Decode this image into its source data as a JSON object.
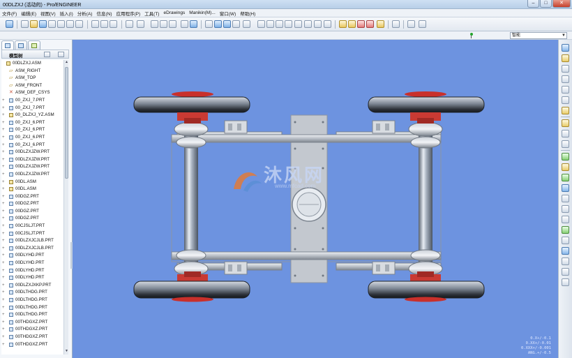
{
  "window": {
    "title": "00DLZXJ (活动的) - Pro/ENGINEER",
    "buttons": {
      "minimize": "–",
      "maximize": "□",
      "close": "✕"
    }
  },
  "menu": [
    "文件(F)",
    "编辑(E)",
    "视图(V)",
    "插入(I)",
    "分析(A)",
    "信息(N)",
    "应用程序(P)",
    "工具(T)",
    "eDrawings",
    "Manikin(M)...",
    "窗口(W)",
    "帮助(H)"
  ],
  "filter": {
    "value": "智能"
  },
  "panel": {
    "title": "模型树"
  },
  "tree": [
    {
      "label": "00DLZXJ.ASM",
      "icon": "asm",
      "exp": ""
    },
    {
      "label": "ASM_RIGHT",
      "icon": "datum",
      "exp": ""
    },
    {
      "label": "ASM_TOP",
      "icon": "datum",
      "exp": ""
    },
    {
      "label": "ASM_FRONT",
      "icon": "datum",
      "exp": ""
    },
    {
      "label": "ASM_DEF_CSYS",
      "icon": "csys",
      "exp": ""
    },
    {
      "label": "00_ZXJ_7.PRT",
      "icon": "part",
      "exp": "+"
    },
    {
      "label": "00_ZXJ_7.PRT",
      "icon": "part",
      "exp": "+"
    },
    {
      "label": "00_DLZXJ_YZ.ASM",
      "icon": "asm",
      "exp": "+"
    },
    {
      "label": "00_ZXJ_6.PRT",
      "icon": "part",
      "exp": "+"
    },
    {
      "label": "00_ZXJ_6.PRT",
      "icon": "part",
      "exp": "+"
    },
    {
      "label": "00_ZXJ_6.PRT",
      "icon": "part",
      "exp": "+"
    },
    {
      "label": "00_ZXJ_6.PRT",
      "icon": "part",
      "exp": "+"
    },
    {
      "label": "00DLZXJZW.PRT",
      "icon": "part",
      "exp": "+"
    },
    {
      "label": "00DLZXJZW.PRT",
      "icon": "part",
      "exp": "+"
    },
    {
      "label": "00DLZXJZW.PRT",
      "icon": "part",
      "exp": "+"
    },
    {
      "label": "00DLZXJZW.PRT",
      "icon": "part",
      "exp": "+"
    },
    {
      "label": "00DL.ASM",
      "icon": "asm",
      "exp": "+"
    },
    {
      "label": "00DL.ASM",
      "icon": "asm",
      "exp": "+"
    },
    {
      "label": "00DGZ.PRT",
      "icon": "part",
      "exp": "+"
    },
    {
      "label": "00DGZ.PRT",
      "icon": "part",
      "exp": "+"
    },
    {
      "label": "00DGZ.PRT",
      "icon": "part",
      "exp": "+"
    },
    {
      "label": "00DGZ.PRT",
      "icon": "part",
      "exp": "+"
    },
    {
      "label": "00CJSLJT.PRT",
      "icon": "part",
      "exp": "+"
    },
    {
      "label": "00CJSLJT.PRT",
      "icon": "part",
      "exp": "+"
    },
    {
      "label": "00DLZXJCJLB.PRT",
      "icon": "part",
      "exp": "+"
    },
    {
      "label": "00DLZXJCJLB.PRT",
      "icon": "part",
      "exp": "+"
    },
    {
      "label": "00DLYHD.PRT",
      "icon": "part",
      "exp": "+"
    },
    {
      "label": "00DLYHD.PRT",
      "icon": "part",
      "exp": "+"
    },
    {
      "label": "00DLYHD.PRT",
      "icon": "part",
      "exp": "+"
    },
    {
      "label": "00DLYHD.PRT",
      "icon": "part",
      "exp": "+"
    },
    {
      "label": "00DLZXJXKP.PRT",
      "icon": "part",
      "exp": "+"
    },
    {
      "label": "00DLTHDG.PRT",
      "icon": "part",
      "exp": "+"
    },
    {
      "label": "00DLTHDG.PRT",
      "icon": "part",
      "exp": "+"
    },
    {
      "label": "00DLTHDG.PRT",
      "icon": "part",
      "exp": "+"
    },
    {
      "label": "00DLTHDG.PRT",
      "icon": "part",
      "exp": "+"
    },
    {
      "label": "00THDGXZ.PRT",
      "icon": "part",
      "exp": "+"
    },
    {
      "label": "00THDGXZ.PRT",
      "icon": "part",
      "exp": "+"
    },
    {
      "label": "00THDGXZ.PRT",
      "icon": "part",
      "exp": "+"
    },
    {
      "label": "00THDGXZ.PRT",
      "icon": "part",
      "exp": "+"
    }
  ],
  "viewport": {
    "background": "#6d93e0",
    "watermark": {
      "cn": "沐风网",
      "url": "www.mfcad.com"
    },
    "tolerances": [
      "0.X+/-0.1",
      "0.XX+/-0.01",
      "0.XXX+/-0.001",
      "ANG.+/-0.5"
    ]
  }
}
